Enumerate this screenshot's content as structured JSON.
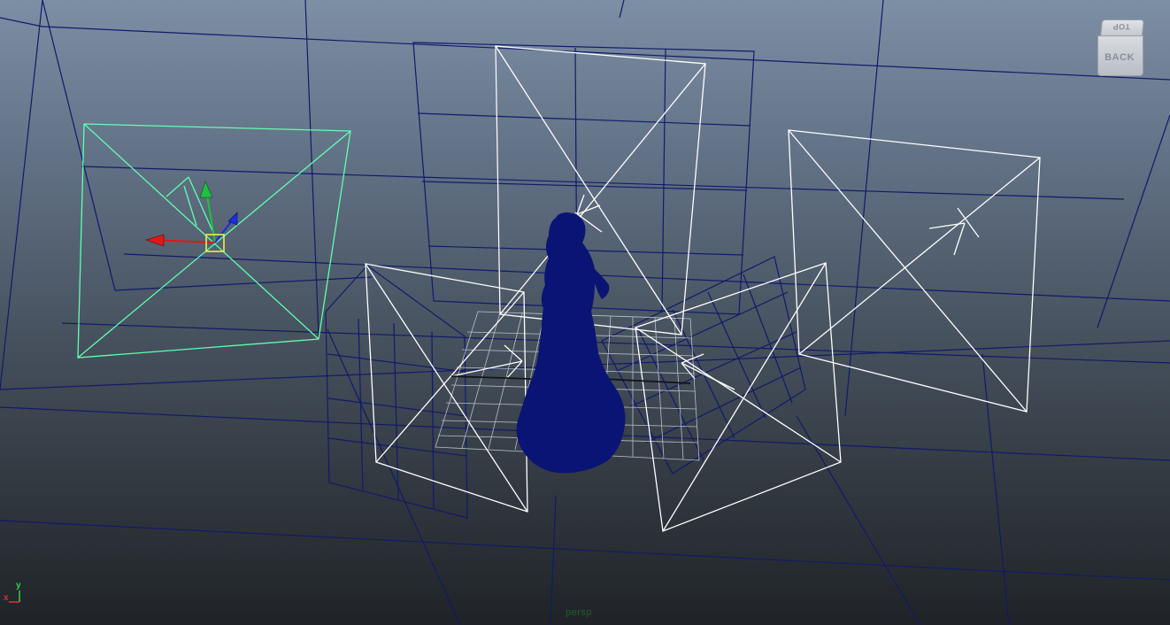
{
  "viewport": {
    "camera_name": "persp"
  },
  "view_cube": {
    "top_label": "TOP",
    "front_label": "BACK"
  },
  "axis_indicator": {
    "x_label": "x",
    "y_label": "y",
    "x_color": "#e03030",
    "y_color": "#30d050"
  },
  "colors": {
    "grid_line": "#101a6a",
    "wireframe": "#ffffff",
    "selected_wireframe": "#60ffb0",
    "character": "#0a1474",
    "manip_x": "#e01818",
    "manip_y": "#20c040",
    "manip_z": "#1c2fd8",
    "manip_center": "#f0f040"
  }
}
